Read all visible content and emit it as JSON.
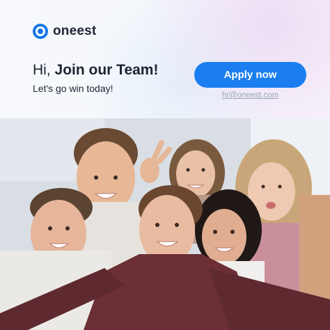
{
  "brand": {
    "name": "oneest",
    "icon": "ring-logo-icon",
    "accent": "#1a7ef0"
  },
  "headline": {
    "greeting": "Hi,",
    "emphasis": "Join our Team!"
  },
  "subline": "Let's go win today!",
  "apply_button": {
    "label": "Apply now"
  },
  "contact_email": "hr@oneest.com",
  "photo": {
    "subject": "team-selfie-image"
  }
}
